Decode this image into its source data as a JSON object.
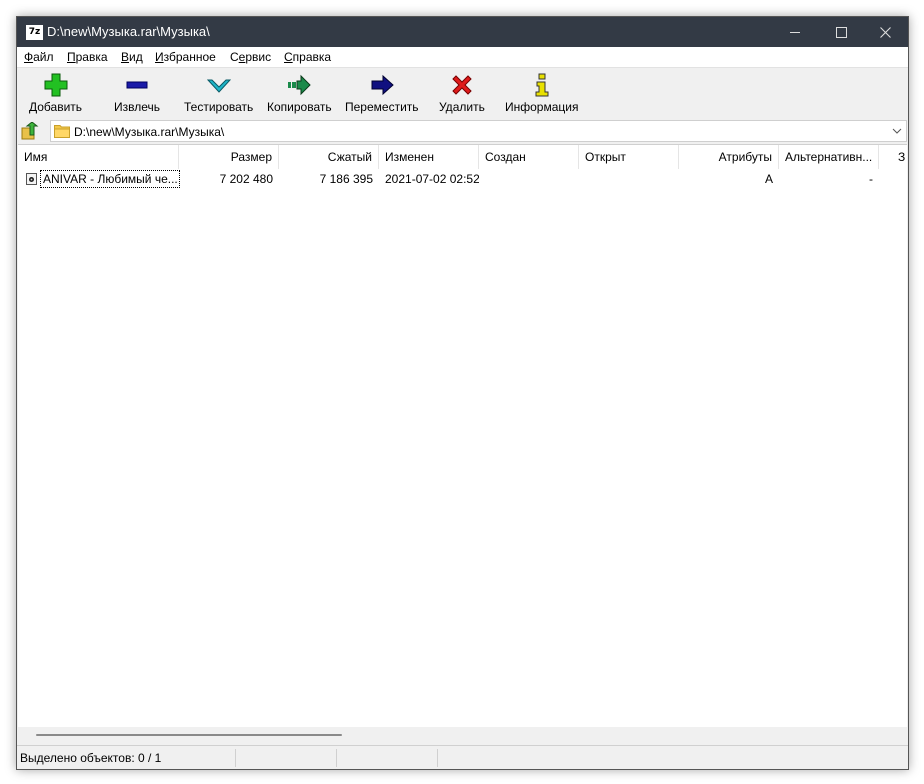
{
  "window": {
    "title": "D:\\new\\Музыка.rar\\Музыка\\",
    "app_icon_text": "7z"
  },
  "menu": {
    "items": [
      {
        "label": "Файл",
        "accel": "Ф",
        "rest": "айл"
      },
      {
        "label": "Правка",
        "accel": "П",
        "rest": "равка"
      },
      {
        "label": "Вид",
        "accel": "В",
        "rest": "ид"
      },
      {
        "label": "Избранное",
        "accel": "И",
        "rest": "збранное"
      },
      {
        "label": "Сервис",
        "pre": "С",
        "accel": "е",
        "rest": "рвис"
      },
      {
        "label": "Справка",
        "accel": "С",
        "rest": "правка"
      }
    ]
  },
  "toolbar": {
    "buttons": [
      {
        "label": "Добавить",
        "icon": "plus-icon"
      },
      {
        "label": "Извлечь",
        "icon": "minus-icon"
      },
      {
        "label": "Тестировать",
        "icon": "check-icon"
      },
      {
        "label": "Копировать",
        "icon": "copy-arrow-icon"
      },
      {
        "label": "Переместить",
        "icon": "move-arrow-icon"
      },
      {
        "label": "Удалить",
        "icon": "delete-x-icon"
      },
      {
        "label": "Информация",
        "icon": "info-icon"
      }
    ]
  },
  "address": {
    "path": "D:\\new\\Музыка.rar\\Музыка\\"
  },
  "columns": {
    "name": "Имя",
    "size": "Размер",
    "packed": "Сжатый",
    "modified": "Изменен",
    "created": "Создан",
    "accessed": "Открыт",
    "attributes": "Атрибуты",
    "alternate": "Альтернативн...",
    "extra": "З"
  },
  "files": [
    {
      "name": "ANIVAR - Любимый че...",
      "size": "7 202 480",
      "packed": "7 186 395",
      "modified": "2021-07-02 02:52",
      "created": "",
      "accessed": "",
      "attributes": "A",
      "alternate": "-"
    }
  ],
  "status": {
    "selected": "Выделено объектов: 0 / 1"
  },
  "colors": {
    "titlebar": "#333a45",
    "window_bg": "#f0f0f0",
    "plus_green": "#22c022",
    "minus_blue": "#1a1aa8",
    "check_cyan": "#1fb5c8",
    "delete_red": "#e01b1b",
    "info_yellow": "#e8e000"
  }
}
